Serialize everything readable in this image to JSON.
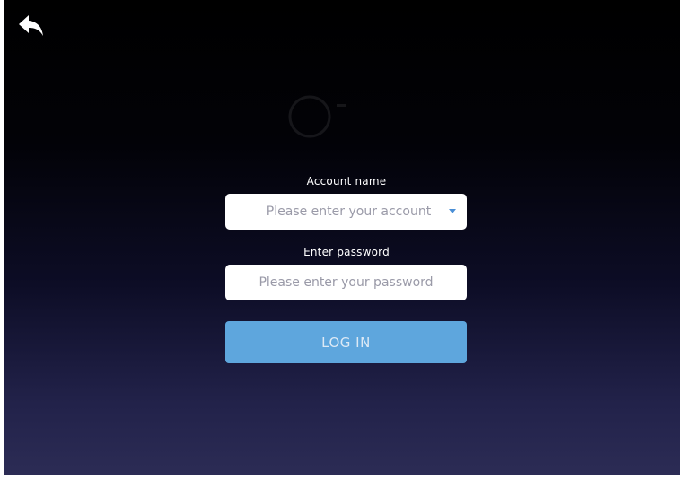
{
  "header": {
    "back_icon": "back-arrow-icon"
  },
  "form": {
    "account_label": "Account name",
    "account_placeholder": "Please enter your account",
    "account_dropdown_icon": "caret-down-icon",
    "password_label": "Enter password",
    "password_placeholder": "Please enter your password",
    "login_label": "LOG IN"
  },
  "colors": {
    "login_button": "#5ea6dd",
    "caret": "#4a8fd6",
    "background_top": "#000000",
    "background_bottom": "#2c2c55"
  }
}
